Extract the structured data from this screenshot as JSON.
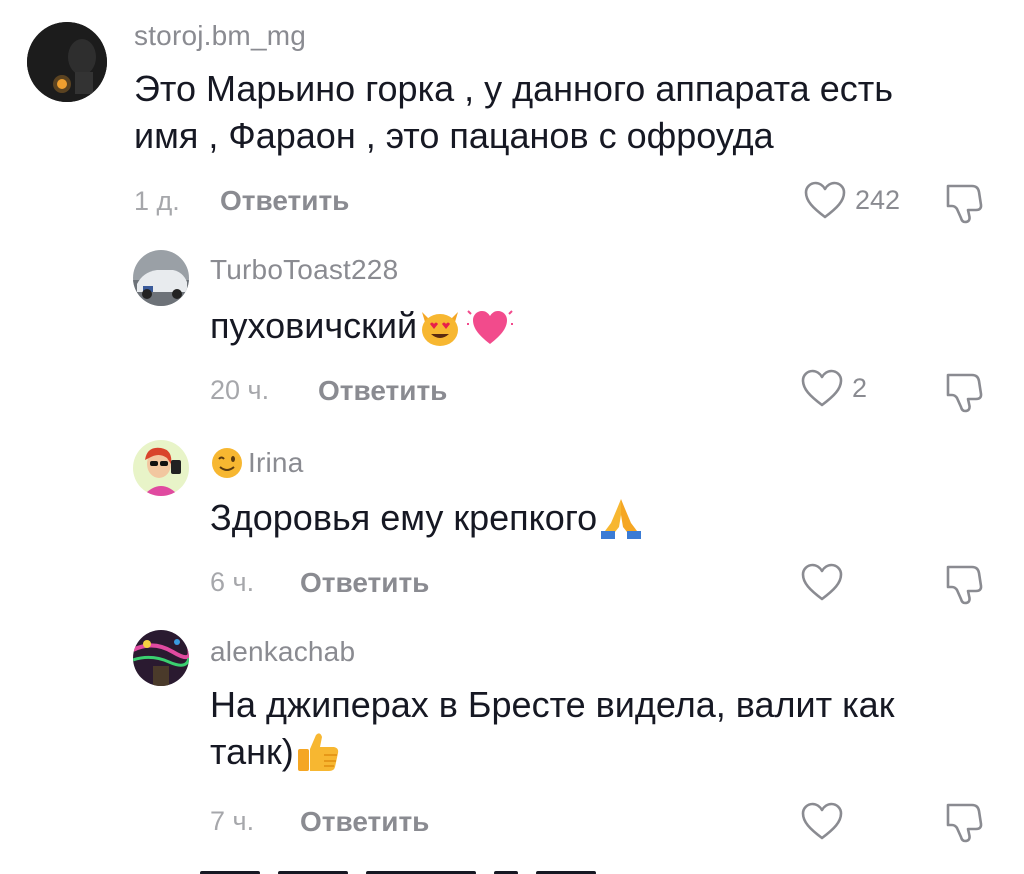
{
  "comments": [
    {
      "username": "storoj.bm_mg",
      "text_lines": [
        "Это Марьино горка , у данного аппарата есть",
        "имя , Фараон , это пацанов с офроуда"
      ],
      "time": "1 д.",
      "reply_label": "Ответить",
      "likes": "242"
    },
    {
      "username": "TurboToast228",
      "text": "пуховичский",
      "emojis": [
        "heart-eyes-cat",
        "growing-heart"
      ],
      "time": "20 ч.",
      "reply_label": "Ответить",
      "likes": "2"
    },
    {
      "username": "Irina",
      "username_emoji": "winking-face",
      "text": "Здоровья ему крепкого",
      "emojis": [
        "folded-hands"
      ],
      "time": "6 ч.",
      "reply_label": "Ответить",
      "likes": ""
    },
    {
      "username": "alenkachab",
      "text_lines": [
        "На джиперах в Бресте видела, валит как",
        "танк)"
      ],
      "emojis": [
        "thumbs-up"
      ],
      "time": "7 ч.",
      "reply_label": "Ответить",
      "likes": ""
    }
  ],
  "icons": {
    "like": "heart-outline-icon",
    "dislike": "thumbs-down-outline-icon"
  },
  "colors": {
    "primary_text": "#161823",
    "secondary_text": "#8a8b91",
    "time_text": "#a6a7ab"
  }
}
